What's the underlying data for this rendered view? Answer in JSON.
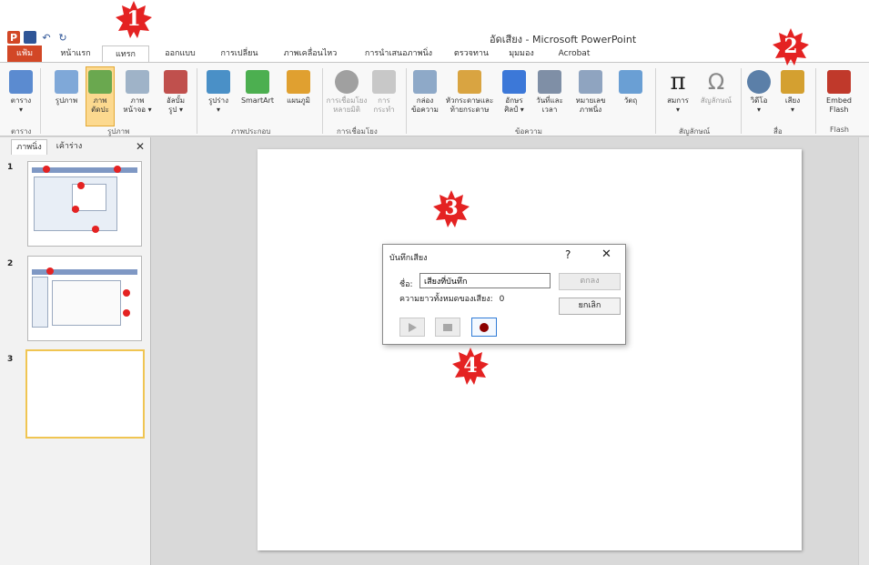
{
  "window": {
    "title": "อัดเสียง - Microsoft PowerPoint",
    "qat": {
      "app_icon": "powerpoint-logo",
      "app_letter": "P",
      "save_icon": "save-icon",
      "undo_icon": "undo-icon",
      "redo_icon": "redo-icon"
    }
  },
  "tabs": [
    {
      "label": "แฟ้ม",
      "active": false,
      "file": true
    },
    {
      "label": "หน้าแรก",
      "active": false
    },
    {
      "label": "แทรก",
      "active": true
    },
    {
      "label": "ออกแบบ",
      "active": false
    },
    {
      "label": "การเปลี่ยน",
      "active": false
    },
    {
      "label": "ภาพเคลื่อนไหว",
      "active": false
    },
    {
      "label": "การนำเสนอภาพนิ่ง",
      "active": false
    },
    {
      "label": "ตรวจทาน",
      "active": false
    },
    {
      "label": "มุมมอง",
      "active": false
    },
    {
      "label": "Acrobat",
      "active": false
    }
  ],
  "ribbon": {
    "buttons": [
      {
        "label": "ตาราง",
        "sub": "▾",
        "icon": "table-icon",
        "color": "#5b8bd0"
      },
      {
        "label": "รูปภาพ",
        "icon": "picture-icon",
        "color": "#7fa8d8"
      },
      {
        "label": "ภาพ",
        "sub": "ตัดปะ",
        "icon": "clipart-icon",
        "color": "#6aa84f",
        "selected": true
      },
      {
        "label": "ภาพ",
        "sub": "หน้าจอ ▾",
        "icon": "screenshot-icon",
        "color": "#9fb3c8"
      },
      {
        "label": "อัลบั้ม",
        "sub": "รูป ▾",
        "icon": "photo-album-icon",
        "color": "#c0504d"
      },
      {
        "label": "รูปร่าง",
        "sub": "▾",
        "icon": "shapes-icon",
        "color": "#4a90c7"
      },
      {
        "label": "SmartArt",
        "icon": "smartart-icon",
        "color": "#4caf50"
      },
      {
        "label": "แผนภูมิ",
        "icon": "chart-icon",
        "color": "#e0a030"
      },
      {
        "label": "การเชื่อมโยง",
        "sub": "หลายมิติ",
        "icon": "hyperlink-icon",
        "color": "#a0a0a0",
        "dim": true
      },
      {
        "label": "การ",
        "sub": "กระทำ",
        "icon": "action-icon",
        "color": "#c8c8c8",
        "dim": true
      },
      {
        "label": "กล่อง",
        "sub": "ข้อความ",
        "icon": "textbox-icon",
        "color": "#8ea9c8"
      },
      {
        "label": "หัวกระดาษและ",
        "sub": "ท้ายกระดาษ",
        "icon": "header-footer-icon",
        "color": "#d9a441"
      },
      {
        "label": "อักษร",
        "sub": "ศิลป์ ▾",
        "icon": "wordart-icon",
        "color": "#3c78d8"
      },
      {
        "label": "วันที่และ",
        "sub": "เวลา",
        "icon": "date-time-icon",
        "color": "#7f8fa6"
      },
      {
        "label": "หมายเลข",
        "sub": "ภาพนิ่ง",
        "icon": "slide-number-icon",
        "color": "#8fa4c0"
      },
      {
        "label": "วัตถุ",
        "icon": "object-icon",
        "color": "#6a9fd4"
      },
      {
        "label": "สมการ",
        "sub": "▾",
        "icon": "equation-icon",
        "color": "#333333"
      },
      {
        "label": "สัญลักษณ์",
        "icon": "symbol-icon",
        "color": "#666666",
        "dim": true
      },
      {
        "label": "วิดีโอ",
        "sub": "▾",
        "icon": "video-icon",
        "color": "#5b7fa8"
      },
      {
        "label": "เสียง",
        "sub": "▾",
        "icon": "audio-icon",
        "color": "#d4a030"
      },
      {
        "label": "Embed",
        "sub": "Flash",
        "icon": "flash-icon",
        "color": "#c0392b"
      }
    ],
    "groups": [
      "ตาราง",
      "รูปภาพ",
      "ภาพประกอบ",
      "การเชื่อมโยง",
      "ข้อความ",
      "สัญลักษณ์",
      "สื่อ",
      "Flash"
    ]
  },
  "slides_panel": {
    "tabs": [
      "ภาพนิ่ง",
      "เค้าร่าง"
    ],
    "close": "✕",
    "slides": [
      {
        "number": "1",
        "current": false
      },
      {
        "number": "2",
        "current": false
      },
      {
        "number": "3",
        "current": true
      }
    ]
  },
  "dialog": {
    "title": "บันทึกเสียง",
    "help": "?",
    "close": "✕",
    "name_label": "ชื่อ:",
    "name_value": "เสียงที่บันทึก",
    "length_label": "ความยาวทั้งหมดของเสียง:",
    "length_value": "0",
    "ok_label": "ตกลง",
    "cancel_label": "ยกเลิก",
    "controls": [
      "play-icon",
      "stop-icon",
      "record-icon"
    ]
  },
  "callouts": [
    "1",
    "2",
    "3",
    "4"
  ],
  "colors": {
    "accent": "#d24726",
    "badge": "#e42222"
  }
}
